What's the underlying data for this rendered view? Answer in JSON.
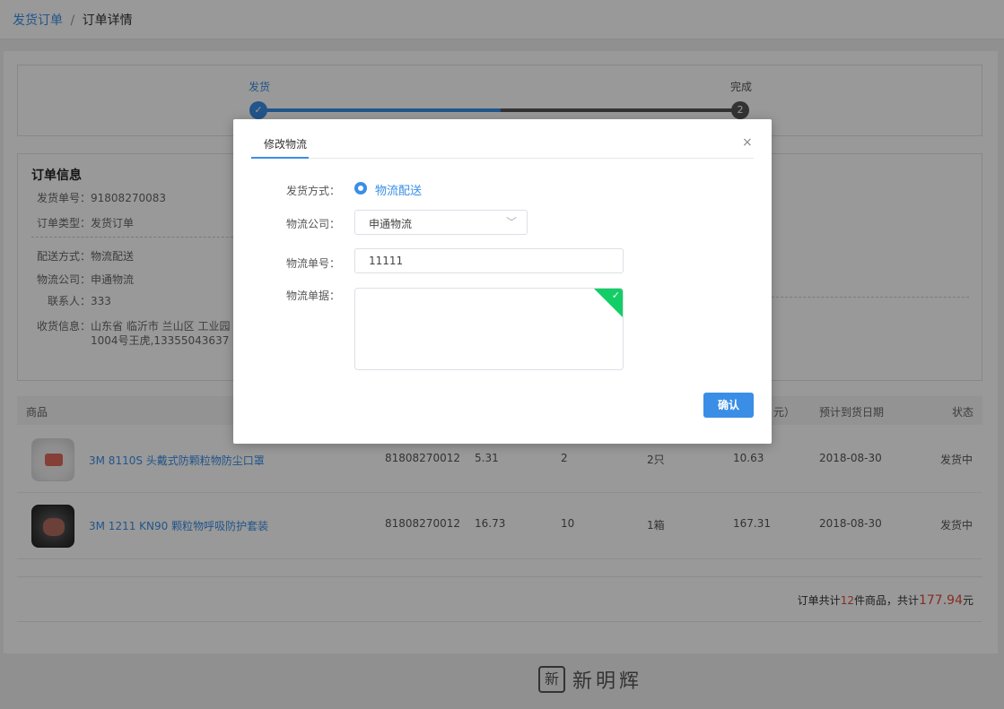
{
  "breadcrumb": {
    "parent": "发货订单",
    "separator": "/",
    "current": "订单详情"
  },
  "steps": [
    {
      "label": "发货",
      "marker": "✓",
      "state": "done"
    },
    {
      "label": "完成",
      "marker": "2",
      "state": "pending"
    }
  ],
  "order_info": {
    "title": "订单信息",
    "ship_no_label": "发货单号：",
    "ship_no": "91808270083",
    "order_type_label": "订单类型：",
    "order_type": "发货订单",
    "delivery_label": "配送方式：",
    "delivery": "物流配送",
    "logistics_label": "物流公司：",
    "logistics": "申通物流",
    "contact_label": "联系人：",
    "contact": "333",
    "address_label": "收货信息：",
    "address_line1": "山东省 临沂市 兰山区 工业园",
    "address_line2": "1004号王虎,13355043637"
  },
  "table": {
    "headers": {
      "product": "商品",
      "eta": "预计到货日期",
      "status": "状态",
      "amount_tail": "元）"
    },
    "rows": [
      {
        "name": "3M 8110S 头戴式防颗粒物防尘口罩",
        "code": "81808270012",
        "price": "5.31",
        "qty": "2",
        "unit_qty": "2只",
        "amount": "10.63",
        "eta": "2018-08-30",
        "status": "发货中"
      },
      {
        "name": "3M 1211 KN90 颗粒物呼吸防护套装",
        "code": "81808270012",
        "price": "16.73",
        "qty": "10",
        "unit_qty": "1箱",
        "amount": "167.31",
        "eta": "2018-08-30",
        "status": "发货中"
      }
    ]
  },
  "total": {
    "prefix": "订单共计",
    "count": "12",
    "mid": "件商品，共计",
    "amount": "177.94",
    "suffix": "元"
  },
  "footer": {
    "logo_seal": "新",
    "logo_text": "新明辉"
  },
  "modal": {
    "title": "修改物流",
    "close": "×",
    "ship_method_label": "发货方式：",
    "ship_method_value": "物流配送",
    "company_label": "物流公司：",
    "company_value": "申通物流",
    "tracking_label": "物流单号：",
    "tracking_value": "11111",
    "receipt_label": "物流单据：",
    "confirm_label": "确认"
  },
  "colors": {
    "accent": "#3a8ee6",
    "success": "#13ce66",
    "price_red": "#e04b3a"
  }
}
